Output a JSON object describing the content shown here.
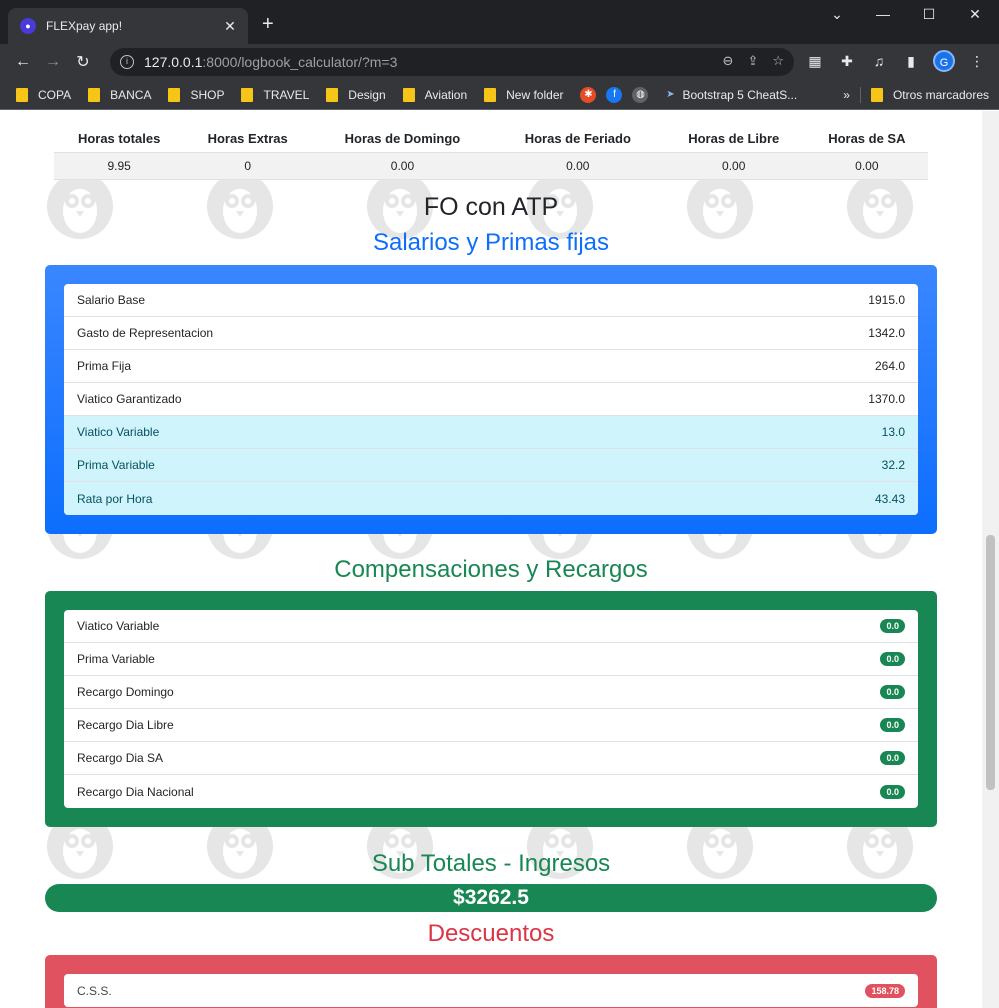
{
  "browser": {
    "tab_title": "FLEXpay app!",
    "url_host": "127.0.0.1",
    "url_path": ":8000/logbook_calculator/?m=3",
    "avatar_letter": "G",
    "bookmarks": [
      {
        "label": "COPA",
        "kind": "folder"
      },
      {
        "label": "BANCA",
        "kind": "folder"
      },
      {
        "label": "SHOP",
        "kind": "folder"
      },
      {
        "label": "TRAVEL",
        "kind": "folder"
      },
      {
        "label": "Design",
        "kind": "folder"
      },
      {
        "label": "Aviation",
        "kind": "folder"
      },
      {
        "label": "New folder",
        "kind": "folder"
      },
      {
        "label": "Bootstrap 5 CheatS...",
        "kind": "link"
      }
    ],
    "other_bookmarks": "Otros marcadores"
  },
  "hours": {
    "headers": [
      "Horas totales",
      "Horas Extras",
      "Horas de Domingo",
      "Horas de Feriado",
      "Horas de Libre",
      "Horas de SA"
    ],
    "values": [
      "9.95",
      "0",
      "0.00",
      "0.00",
      "0.00",
      "0.00"
    ]
  },
  "section_title": "FO con ATP",
  "salarios": {
    "title": "Salarios y Primas fijas",
    "items": [
      {
        "label": "Salario Base",
        "value": "1915.0"
      },
      {
        "label": "Gasto de Representacion",
        "value": "1342.0"
      },
      {
        "label": "Prima Fija",
        "value": "264.0"
      },
      {
        "label": "Viatico Garantizado",
        "value": "1370.0"
      },
      {
        "label": "Viatico Variable",
        "value": "13.0"
      },
      {
        "label": "Prima Variable",
        "value": "32.2"
      },
      {
        "label": "Rata por Hora",
        "value": "43.43"
      }
    ]
  },
  "compensaciones": {
    "title": "Compensaciones y Recargos",
    "items": [
      {
        "label": "Viatico Variable",
        "value": "0.0"
      },
      {
        "label": "Prima Variable",
        "value": "0.0"
      },
      {
        "label": "Recargo Domingo",
        "value": "0.0"
      },
      {
        "label": "Recargo Dia Libre",
        "value": "0.0"
      },
      {
        "label": "Recargo Dia SA",
        "value": "0.0"
      },
      {
        "label": "Recargo Dia Nacional",
        "value": "0.0"
      }
    ]
  },
  "subtotal": {
    "title": "Sub Totales - Ingresos",
    "value": "$3262.5"
  },
  "descuentos": {
    "title": "Descuentos",
    "items": [
      {
        "label": "C.S.S.",
        "value": "158.78"
      }
    ]
  },
  "colors": {
    "primary": "#0d6efd",
    "success": "#198754",
    "danger": "#dc3545",
    "info_row": "#cff4fc"
  }
}
